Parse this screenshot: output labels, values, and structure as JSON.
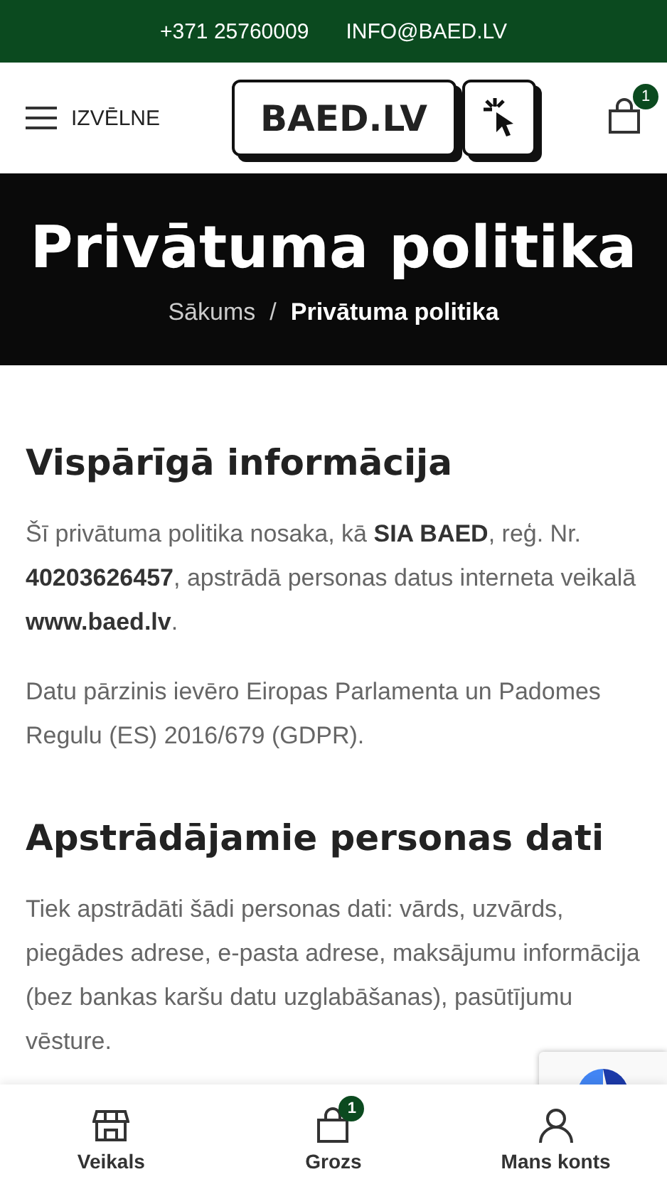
{
  "top_bar": {
    "phone": "+371 25760009",
    "email": "INFO@BAED.LV"
  },
  "header": {
    "menu_label": "IZVĒLNE",
    "logo_text": "BAED.LV",
    "cart_count": "1"
  },
  "hero": {
    "title": "Privātuma politika",
    "breadcrumb": [
      {
        "label": "Sākums",
        "selected": false
      },
      {
        "label": "Privātuma politika",
        "selected": true
      }
    ],
    "separator": "/"
  },
  "content": [
    {
      "kind": "heading",
      "text": "Vispārīgā informācija"
    },
    {
      "kind": "paragraph",
      "text": "Šī privātuma politika nosaka, kā **SIA BAED**, reģ. Nr. **40203626457**, apstrādā personas datus interneta veikalā **www.baed.lv**."
    },
    {
      "kind": "paragraph",
      "text": "Datu pārzinis ievēro Eiropas Parlamenta un Padomes Regulu (ES) 2016/679 (GDPR)."
    },
    {
      "kind": "heading",
      "text": "Apstrādājamie personas dati"
    },
    {
      "kind": "paragraph",
      "text": "Tiek apstrādāti šādi personas dati: vārds, uzvārds, piegādes adrese, e-pasta adrese, maksājumu informācija (bez bankas karšu datu uzglabāšanas), pasūtījumu vēsture."
    }
  ],
  "bottom_nav": [
    {
      "kind": "shop",
      "label": "Veikals"
    },
    {
      "kind": "cart",
      "label": "Grozs",
      "badge": "1"
    },
    {
      "kind": "account",
      "label": "Mans konts"
    }
  ]
}
